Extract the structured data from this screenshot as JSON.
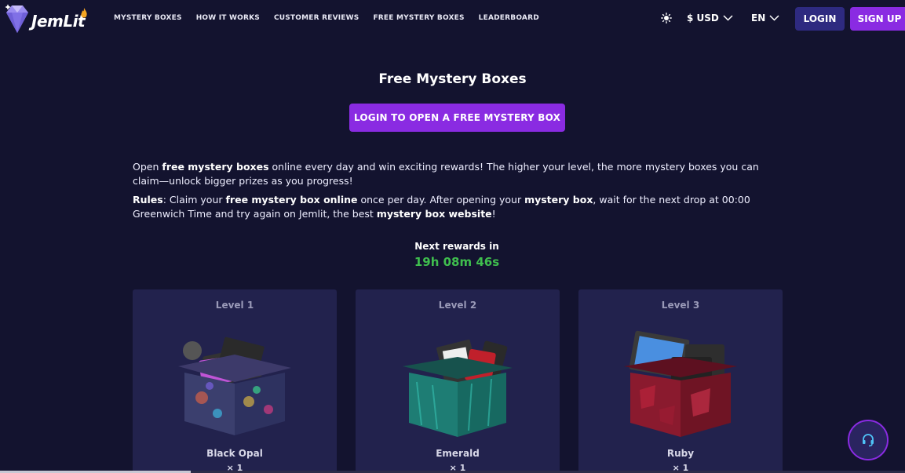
{
  "brand": {
    "name": "JemLit"
  },
  "nav": [
    {
      "label": "MYSTERY BOXES"
    },
    {
      "label": "HOW IT WORKS"
    },
    {
      "label": "CUSTOMER REVIEWS"
    },
    {
      "label": "FREE MYSTERY BOXES"
    },
    {
      "label": "LEADERBOARD"
    }
  ],
  "header": {
    "theme_icon": "sun-icon",
    "currency": "$ USD",
    "language": "EN",
    "login_label": "LOGIN",
    "signup_label": "SIGN UP"
  },
  "main": {
    "title": "Free Mystery Boxes",
    "cta_label": "LOGIN TO OPEN A FREE MYSTERY BOX",
    "intro": {
      "t1": "Open ",
      "b1": "free mystery boxes",
      "t2": " online every day and win exciting rewards! The higher your level, the more mystery boxes you can claim—unlock bigger prizes as you progress!"
    },
    "rules": {
      "b0": "Rules",
      "t1": ": Claim your ",
      "b1": "free mystery box online",
      "t2": " once per day. After opening your ",
      "b2": "mystery box",
      "t3": ", wait for the next drop at 00:00 Greenwich Time and try again on Jemlit, the best ",
      "b3": "mystery box website",
      "t4": "!"
    },
    "timer_label": "Next rewards in",
    "timer_value": "19h 08m 46s"
  },
  "cards": [
    {
      "level": "Level 1",
      "name": "Black Opal",
      "qty": "× 1",
      "color": "#4a4a78"
    },
    {
      "level": "Level 2",
      "name": "Emerald",
      "qty": "× 1",
      "color": "#1f8c80"
    },
    {
      "level": "Level 3",
      "name": "Ruby",
      "qty": "× 1",
      "color": "#9b1b33"
    }
  ],
  "colors": {
    "background": "#13132f",
    "card": "#22224d",
    "accent": "#8a2be2",
    "login_button": "#2e2a80",
    "timer": "#3fbe4e"
  },
  "support_icon": "headset-icon"
}
